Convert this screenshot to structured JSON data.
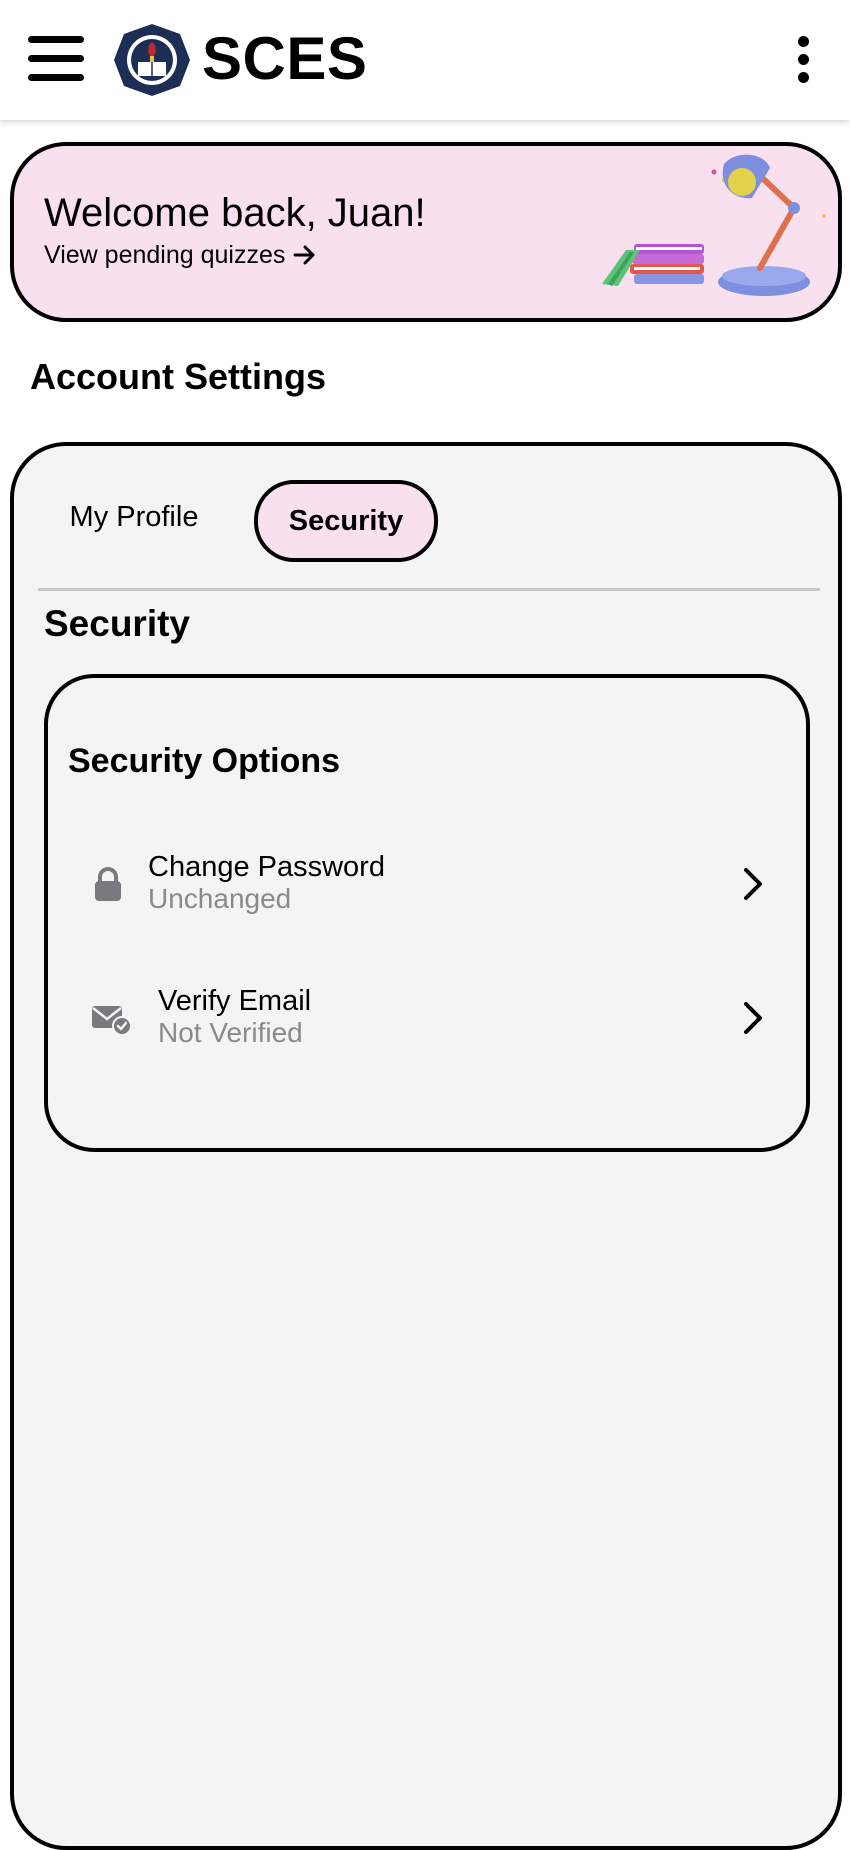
{
  "app": {
    "title": "SCES"
  },
  "icons": {
    "menu": "hamburger-menu-icon",
    "more": "kebab-more-icon",
    "logo": "school-seal-logo",
    "arrow": "arrow-right-icon",
    "lock": "lock-icon",
    "mail": "mail-check-icon",
    "chevron": "chevron-right-icon"
  },
  "colors": {
    "accent_pink": "#f9e0ef",
    "panel_bg": "#f4f4f4",
    "muted_text": "#8a8a8a",
    "icon_gray": "#7a7a7e"
  },
  "banner": {
    "greeting": "Welcome back, Juan!",
    "link_label": "View pending quizzes"
  },
  "page": {
    "title": "Account Settings"
  },
  "tabs": [
    {
      "label": "My Profile",
      "active": false
    },
    {
      "label": "Security",
      "active": true
    }
  ],
  "security": {
    "heading": "Security",
    "card_title": "Security Options",
    "options": [
      {
        "label": "Change Password",
        "status": "Unchanged",
        "icon": "lock-icon"
      },
      {
        "label": "Verify Email",
        "status": "Not Verified",
        "icon": "mail-check-icon"
      }
    ]
  }
}
